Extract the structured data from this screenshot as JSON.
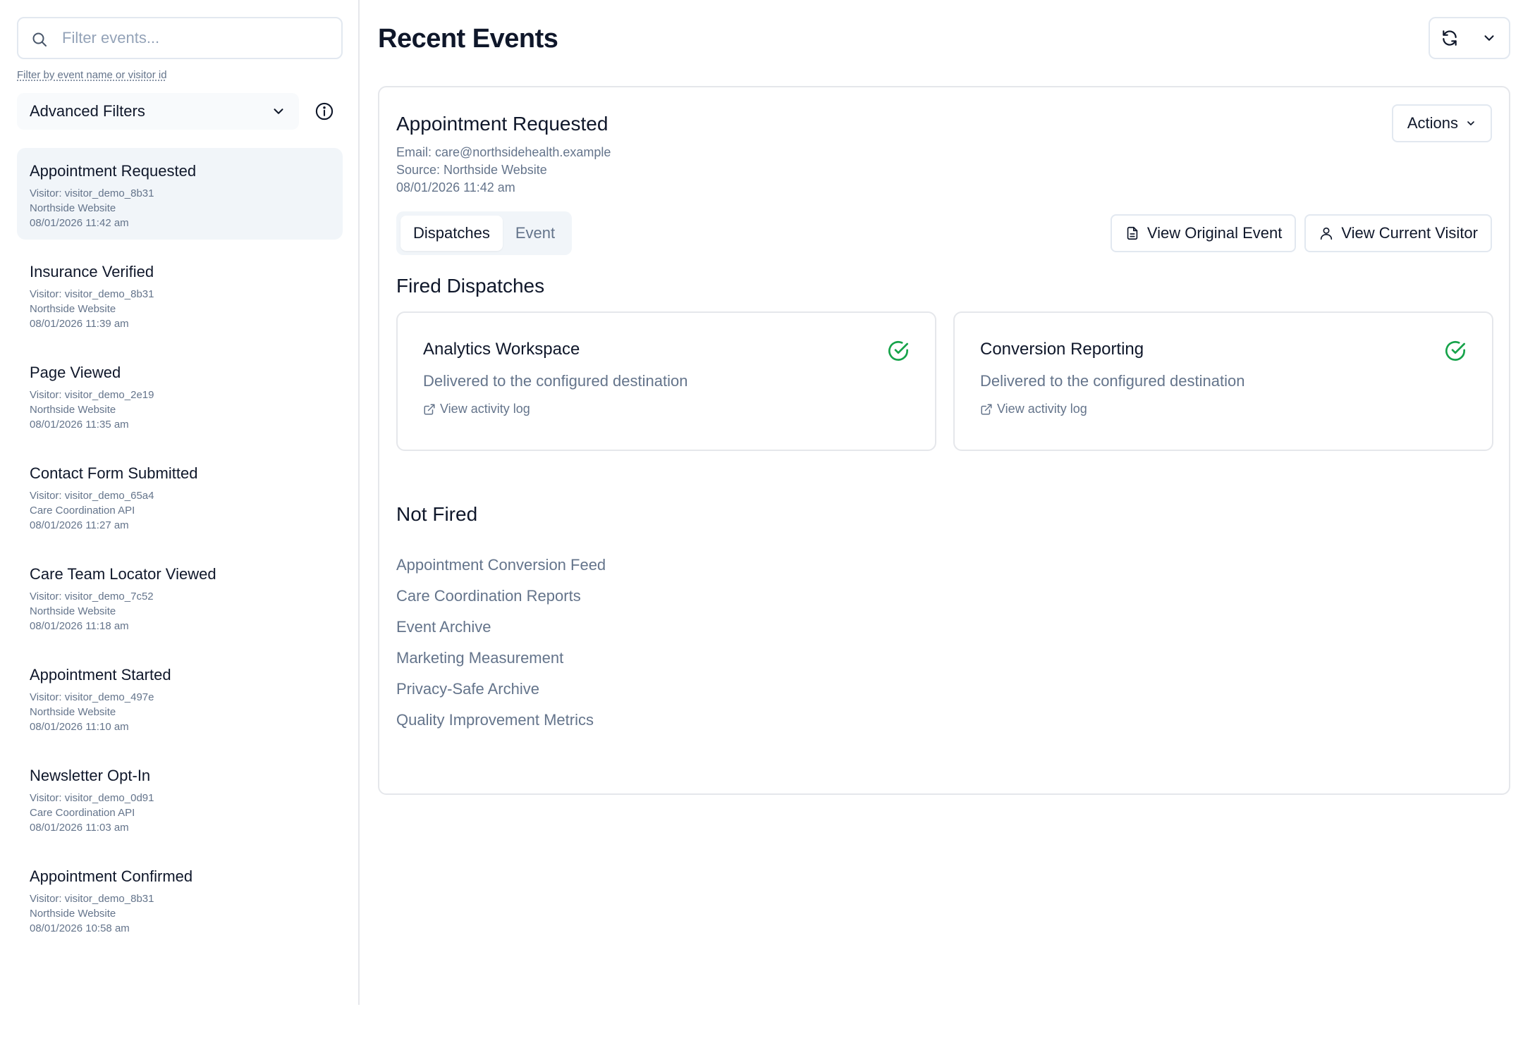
{
  "sidebar": {
    "search": {
      "placeholder": "Filter events...",
      "value": ""
    },
    "filter_hint": "Filter by event name or visitor id",
    "advanced_filters_label": "Advanced Filters",
    "events": [
      {
        "title": "Appointment Requested",
        "visitor": "Visitor: visitor_demo_8b31",
        "source": "Northside Website",
        "time": "08/01/2026 11:42 am",
        "active": true
      },
      {
        "title": "Insurance Verified",
        "visitor": "Visitor: visitor_demo_8b31",
        "source": "Northside Website",
        "time": "08/01/2026 11:39 am"
      },
      {
        "title": "Page Viewed",
        "visitor": "Visitor: visitor_demo_2e19",
        "source": "Northside Website",
        "time": "08/01/2026 11:35 am"
      },
      {
        "title": "Contact Form Submitted",
        "visitor": "Visitor: visitor_demo_65a4",
        "source": "Care Coordination API",
        "time": "08/01/2026 11:27 am"
      },
      {
        "title": "Care Team Locator Viewed",
        "visitor": "Visitor: visitor_demo_7c52",
        "source": "Northside Website",
        "time": "08/01/2026 11:18 am"
      },
      {
        "title": "Appointment Started",
        "visitor": "Visitor: visitor_demo_497e",
        "source": "Northside Website",
        "time": "08/01/2026 11:10 am"
      },
      {
        "title": "Newsletter Opt-In",
        "visitor": "Visitor: visitor_demo_0d91",
        "source": "Care Coordination API",
        "time": "08/01/2026 11:03 am"
      },
      {
        "title": "Appointment Confirmed",
        "visitor": "Visitor: visitor_demo_8b31",
        "source": "Northside Website",
        "time": "08/01/2026 10:58 am"
      }
    ]
  },
  "main": {
    "title": "Recent Events",
    "detail": {
      "title": "Appointment Requested",
      "email": "Email: care@northsidehealth.example",
      "source": "Source: Northside Website",
      "time": "08/01/2026 11:42 am",
      "actions_label": "Actions",
      "tabs": [
        {
          "label": "Dispatches",
          "active": true
        },
        {
          "label": "Event",
          "active": false
        }
      ],
      "view_original_label": "View Original Event",
      "view_visitor_label": "View Current Visitor",
      "fired_title": "Fired Dispatches",
      "fired": [
        {
          "name": "Analytics Workspace",
          "desc": "Delivered to the configured destination",
          "link": "View activity log"
        },
        {
          "name": "Conversion Reporting",
          "desc": "Delivered to the configured destination",
          "link": "View activity log"
        }
      ],
      "not_fired_title": "Not Fired",
      "not_fired": [
        "Appointment Conversion Feed",
        "Care Coordination Reports",
        "Event Archive",
        "Marketing Measurement",
        "Privacy-Safe Archive",
        "Quality Improvement Metrics"
      ]
    }
  },
  "colors": {
    "success": "#16a34a",
    "muted": "#64748b",
    "border": "#e5e7eb",
    "active_bg": "#f1f5f9"
  },
  "icons": [
    "search-icon",
    "chevron-down-icon",
    "info-icon",
    "refresh-icon",
    "file-icon",
    "user-icon",
    "check-circle-icon",
    "external-link-icon"
  ]
}
